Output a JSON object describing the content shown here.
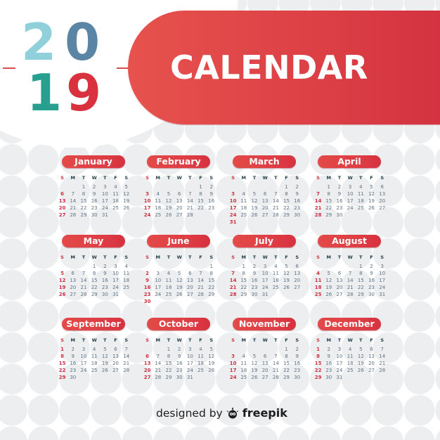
{
  "header": {
    "year_digits": [
      "2",
      "0",
      "1",
      "9"
    ],
    "title": "CALENDAR"
  },
  "colors": {
    "digit_2": "#8fd0da",
    "digit_0": "#5b85a5",
    "digit_1": "#27a08f",
    "digit_9": "#d9323e",
    "accent_red": "#dc3f45",
    "sunday_red": "#d03040",
    "day_text": "#5f7384",
    "weekday_text": "#20404a",
    "background_circle": "#eceef0"
  },
  "weekdays": [
    "S",
    "M",
    "T",
    "W",
    "T",
    "F",
    "S"
  ],
  "months": [
    {
      "name": "January",
      "start": 2,
      "days": 31
    },
    {
      "name": "February",
      "start": 5,
      "days": 28
    },
    {
      "name": "March",
      "start": 5,
      "days": 31
    },
    {
      "name": "April",
      "start": 1,
      "days": 30
    },
    {
      "name": "May",
      "start": 3,
      "days": 31
    },
    {
      "name": "June",
      "start": 6,
      "days": 30
    },
    {
      "name": "July",
      "start": 1,
      "days": 31
    },
    {
      "name": "August",
      "start": 4,
      "days": 31
    },
    {
      "name": "September",
      "start": 0,
      "days": 30
    },
    {
      "name": "October",
      "start": 2,
      "days": 31
    },
    {
      "name": "November",
      "start": 5,
      "days": 30
    },
    {
      "name": "December",
      "start": 0,
      "days": 31
    }
  ],
  "footer": {
    "prefix": "designed by",
    "brand": "freepik",
    "logo_icon": "freepik-logo-icon"
  }
}
